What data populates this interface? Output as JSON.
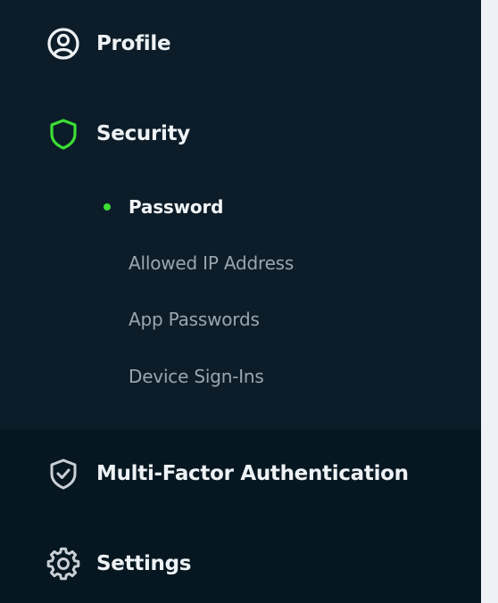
{
  "nav": {
    "profile": {
      "label": "Profile",
      "icon": "user-circle-icon"
    },
    "security": {
      "label": "Security",
      "icon": "shield-icon",
      "icon_color": "#3dde35",
      "sub_items": [
        {
          "label": "Password",
          "active": true
        },
        {
          "label": "Allowed IP Address",
          "active": false
        },
        {
          "label": "App Passwords",
          "active": false
        },
        {
          "label": "Device Sign-Ins",
          "active": false
        }
      ]
    },
    "mfa": {
      "label": "Multi-Factor Authentication",
      "icon": "shield-check-icon"
    },
    "settings": {
      "label": "Settings",
      "icon": "gear-icon"
    }
  },
  "colors": {
    "sidebar_bg": "#0c1d29",
    "sidebar_bottom_bg": "#061721",
    "accent": "#3dde35",
    "text_primary": "#eef2f5",
    "text_secondary": "#9aa6ae"
  }
}
